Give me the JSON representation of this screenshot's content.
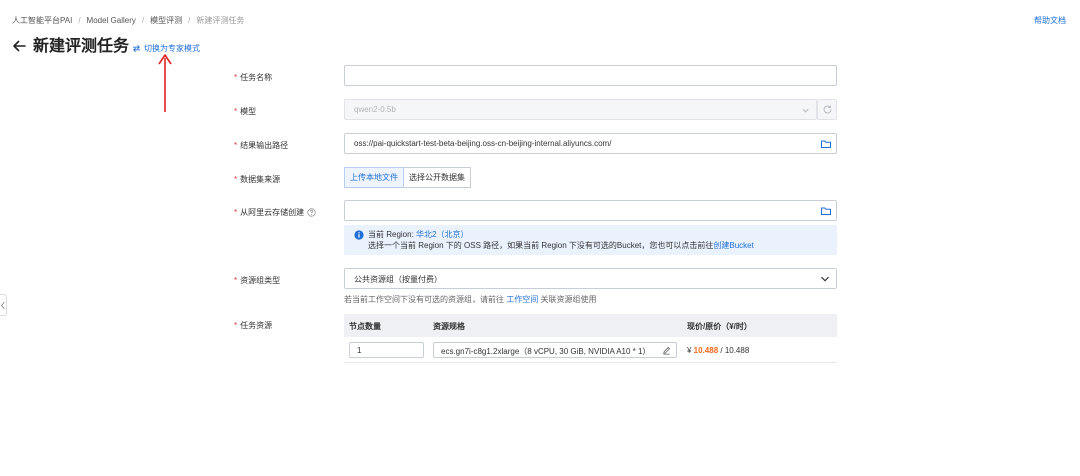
{
  "breadcrumb": [
    {
      "label": "人工智能平台PAI"
    },
    {
      "label": "Model Gallery"
    },
    {
      "label": "模型评测"
    },
    {
      "label": "新建评测任务"
    }
  ],
  "help_link": "帮助文档",
  "title": "新建评测任务",
  "expert_switch": "切换为专家模式",
  "form": {
    "task_name": {
      "label": "任务名称",
      "value": ""
    },
    "model": {
      "label": "模型",
      "value": "qwen2-0.5b"
    },
    "output_path": {
      "label": "结果输出路径",
      "value": "oss://pai-quickstart-test-beta-beijing.oss-cn-beijing-internal.aliyuncs.com/"
    },
    "dataset_source": {
      "label": "数据集来源",
      "options": [
        "上传本地文件",
        "选择公开数据集"
      ],
      "selected": "上传本地文件"
    },
    "oss_create": {
      "label": "从阿里云存储创建",
      "value": "",
      "info_region_prefix": "当前 Region: ",
      "info_region": "华北2（北京）",
      "info_text": "选择一个当前 Region 下的 OSS 路径，如果当前 Region 下没有可选的Bucket，您也可以点击前往",
      "info_link": "创建Bucket"
    },
    "resource_group": {
      "label": "资源组类型",
      "value": "公共资源组（按量付费）",
      "hint_prefix": "若当前工作空间下没有可选的资源组，请前往 ",
      "hint_link": "工作空间",
      "hint_suffix": " 关联资源组使用"
    },
    "task_resource": {
      "label": "任务资源",
      "columns": [
        "节点数量",
        "资源规格",
        "现价/原价（¥/时）"
      ],
      "row": {
        "nodes": "1",
        "spec": "ecs.gn7i-c8g1.2xlarge（8 vCPU, 30 GiB, NVIDIA A10 * 1）",
        "currency": "¥ ",
        "price_now": "10.488",
        "price_sep": " / ",
        "price_orig": "10.488"
      }
    }
  },
  "colors": {
    "accent": "#1f6fd6",
    "required": "#e23b3b",
    "price": "#f06a1c",
    "annotation": "#e02020"
  }
}
